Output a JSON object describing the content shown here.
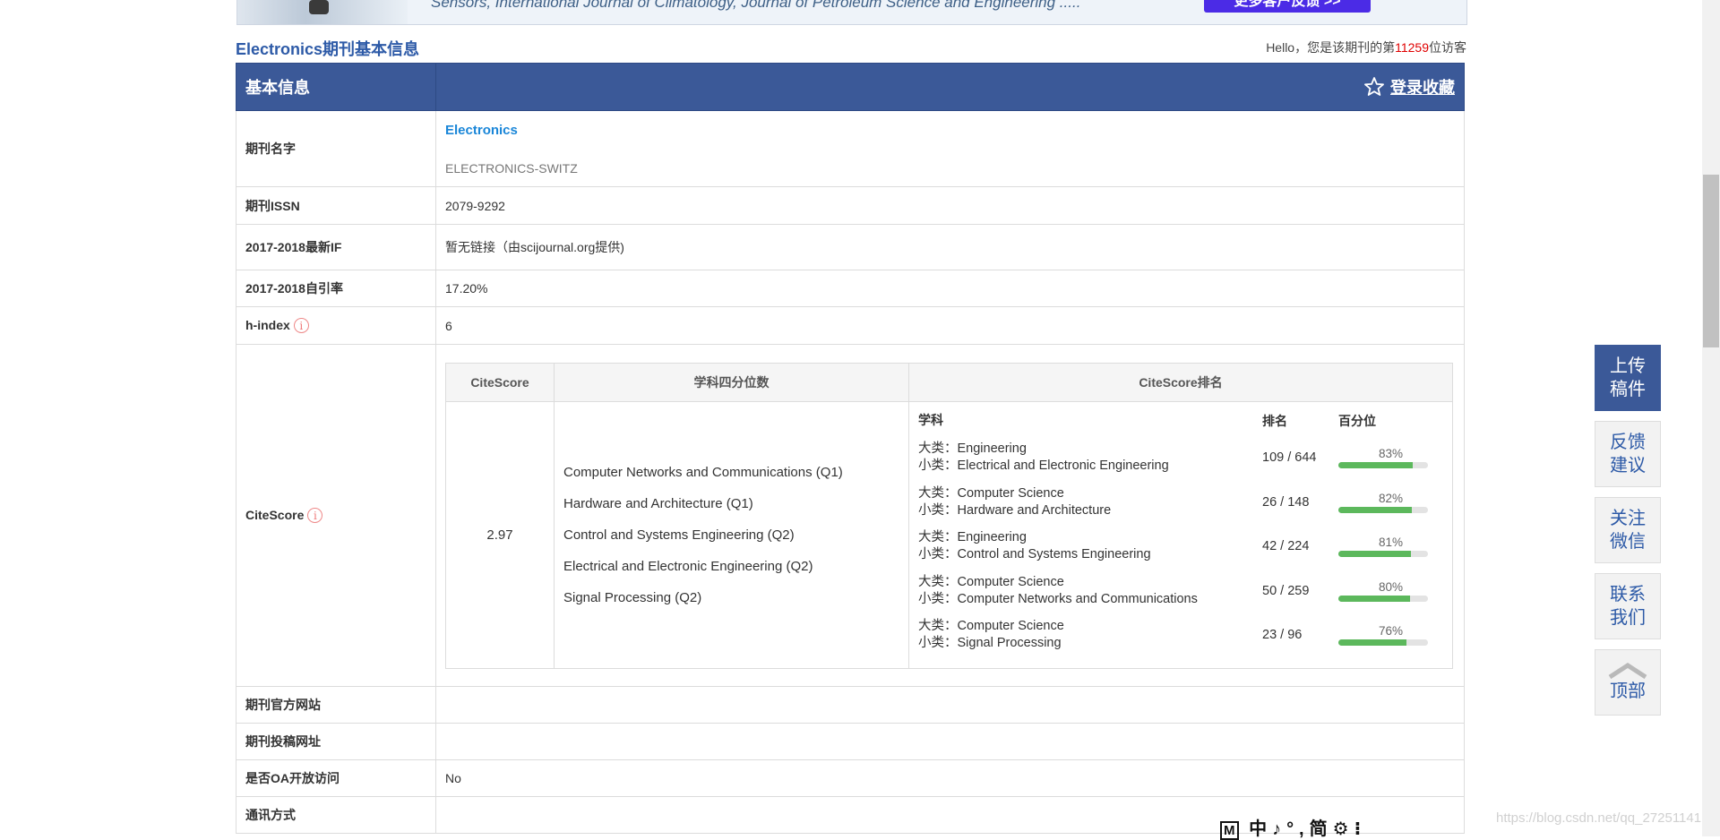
{
  "banner": {
    "text": "Sensors,  International Journal of Climatology,  Journal of Petroleum Science and Engineering .....",
    "button": "更多客户反馈 >>"
  },
  "header": {
    "title": "Electronics期刊基本信息",
    "visitor_prefix": "Hello，您是该期刊的第",
    "visitor_count": "11259",
    "visitor_suffix": "位访客"
  },
  "table": {
    "section_label": "基本信息",
    "favorite_label": "登录收藏",
    "rows": {
      "name": {
        "label": "期刊名字",
        "name": "Electronics",
        "abbr": "ELECTRONICS-SWITZ"
      },
      "issn": {
        "label": "期刊ISSN",
        "value": "2079-9292"
      },
      "if": {
        "label": "2017-2018最新IF",
        "value": "暂无链接（由scijournal.org提供)"
      },
      "selfcite": {
        "label": "2017-2018自引率",
        "value": "17.20%"
      },
      "hindex": {
        "label": "h-index",
        "value": "6"
      },
      "citescore": {
        "label": "CiteScore"
      },
      "website": {
        "label": "期刊官方网站",
        "value": ""
      },
      "submission": {
        "label": "期刊投稿网址",
        "value": ""
      },
      "oa": {
        "label": "是否OA开放访问",
        "value": "No"
      },
      "contact": {
        "label": "通讯方式",
        "value": ""
      }
    }
  },
  "citescore": {
    "headers": [
      "CiteScore",
      "学科四分位数",
      "CiteScore排名"
    ],
    "value": "2.97",
    "quartiles": [
      "Computer Networks and Communications (Q1)",
      "Hardware and Architecture (Q1)",
      "Control and Systems Engineering (Q2)",
      "Electrical and Electronic Engineering (Q2)",
      "Signal Processing (Q2)"
    ],
    "rank_headers": [
      "学科",
      "排名",
      "百分位"
    ],
    "major_prefix": "大类：",
    "minor_prefix": "小类：",
    "rankings": [
      {
        "major": "Engineering",
        "minor": "Electrical and Electronic Engineering",
        "rank": "109 / 644",
        "percentile": 83,
        "percentile_label": "83%"
      },
      {
        "major": "Computer Science",
        "minor": "Hardware and Architecture",
        "rank": "26 / 148",
        "percentile": 82,
        "percentile_label": "82%"
      },
      {
        "major": "Engineering",
        "minor": "Control and Systems Engineering",
        "rank": "42 / 224",
        "percentile": 81,
        "percentile_label": "81%"
      },
      {
        "major": "Computer Science",
        "minor": "Computer Networks and Communications",
        "rank": "50 / 259",
        "percentile": 80,
        "percentile_label": "80%"
      },
      {
        "major": "Computer Science",
        "minor": "Signal Processing",
        "rank": "23 / 96",
        "percentile": 76,
        "percentile_label": "76%"
      }
    ]
  },
  "side_buttons": [
    {
      "line1": "上传",
      "line2": "稿件"
    },
    {
      "line1": "反馈",
      "line2": "建议"
    },
    {
      "line1": "关注",
      "line2": "微信"
    },
    {
      "line1": "联系",
      "line2": "我们"
    },
    {
      "line1": "顶部"
    }
  ],
  "ime": {
    "items": [
      "M",
      "中",
      "♪",
      "°,",
      "简",
      "⚙",
      "⁝"
    ]
  },
  "watermark": "https://blog.csdn.net/qq_27251141"
}
